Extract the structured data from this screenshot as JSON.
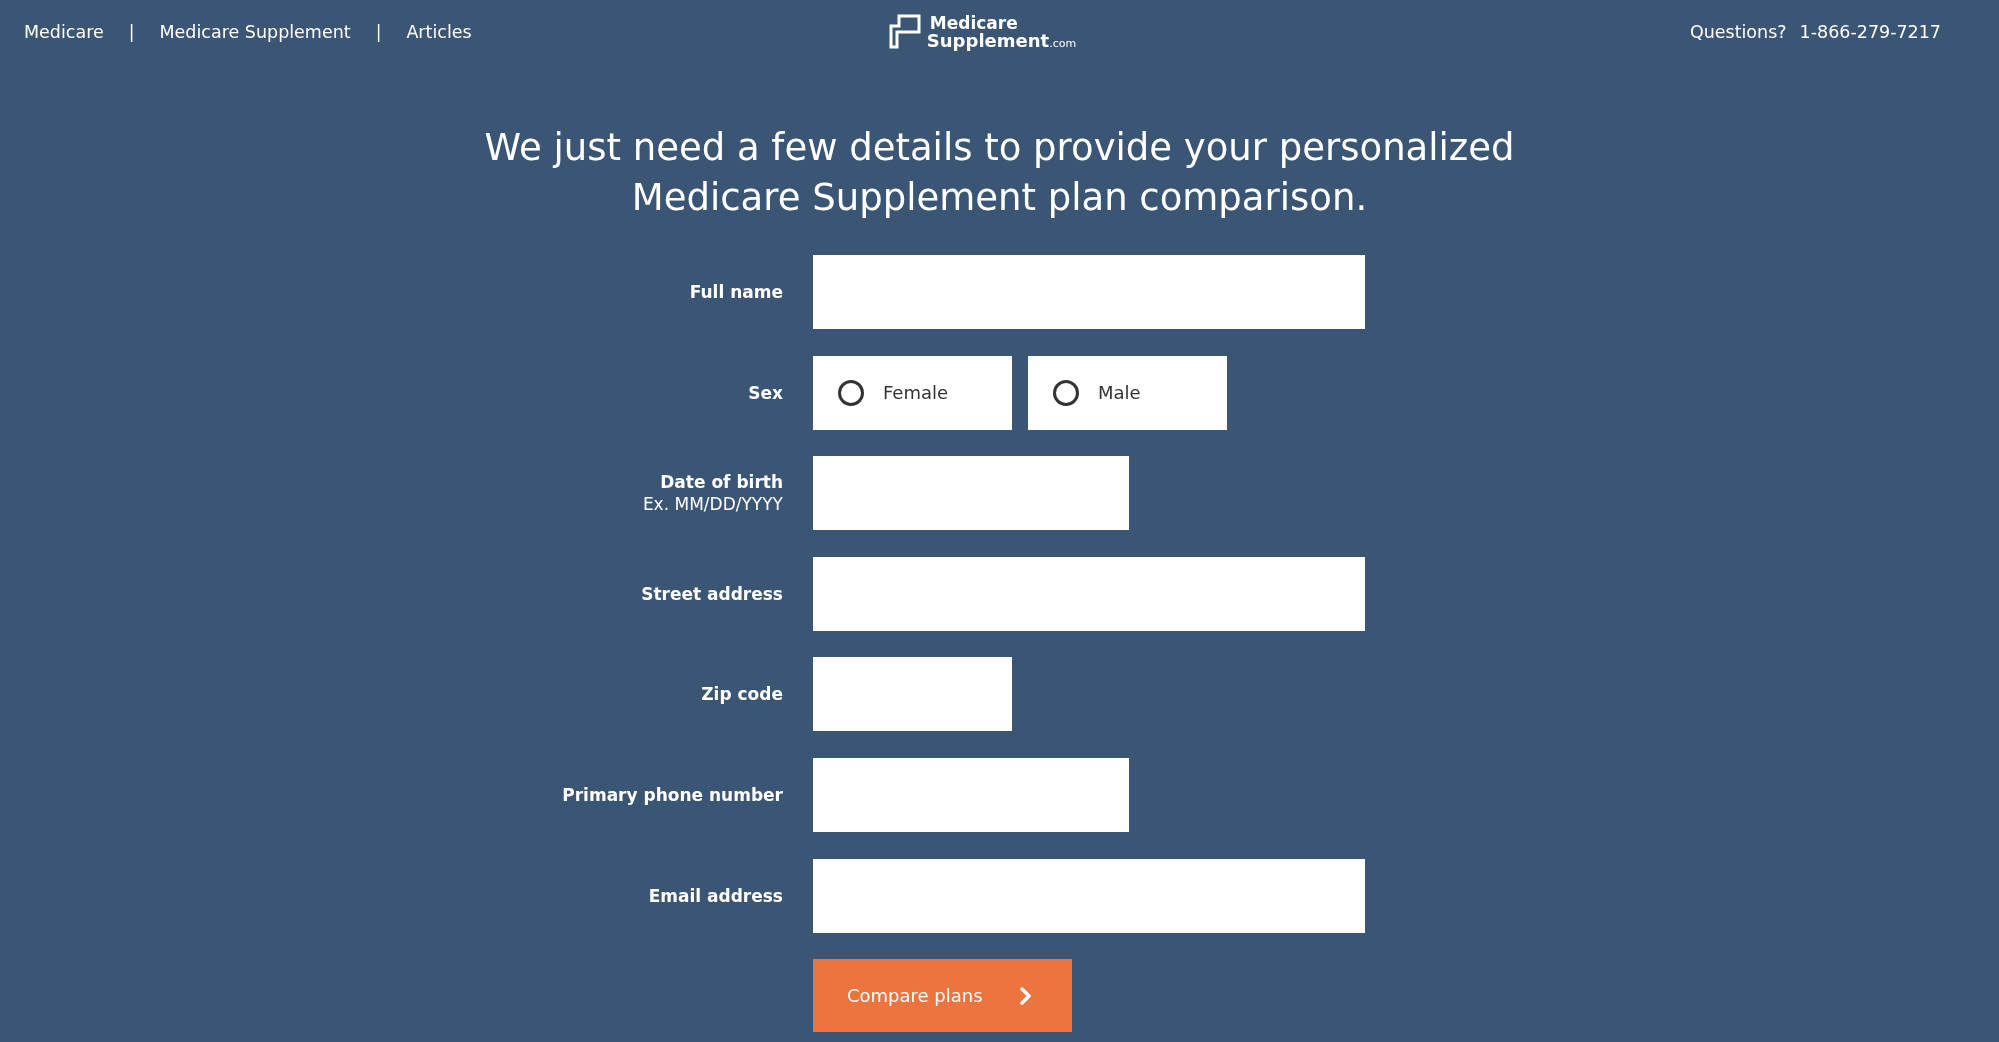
{
  "header": {
    "nav": [
      {
        "kind": "link",
        "text": "Medicare"
      },
      {
        "kind": "separator",
        "text": "|"
      },
      {
        "kind": "link",
        "text": "Medicare Supplement"
      },
      {
        "kind": "separator",
        "text": "|"
      },
      {
        "kind": "link",
        "text": "Articles"
      }
    ],
    "logo": {
      "line_1": "Medicare",
      "line_2": "Supplement",
      "suffix": ".com"
    },
    "contact": {
      "label": "Questions?",
      "phone": "1-866-279-7217"
    }
  },
  "heading": "We just need a few details to provide your personalized Medicare Supplement plan comparison.",
  "form": {
    "fields": [
      {
        "kind": "text",
        "label": "Full name"
      },
      {
        "kind": "radio",
        "label": "Sex",
        "options": [
          {
            "label": "Female",
            "selected": false
          },
          {
            "label": "Male",
            "selected": false
          }
        ]
      },
      {
        "kind": "date",
        "label": "Date of birth",
        "hint": "Ex. MM/DD/YYYY"
      },
      {
        "kind": "text",
        "label": "Street address"
      },
      {
        "kind": "zip",
        "label": "Zip code"
      },
      {
        "kind": "phone",
        "label": "Primary phone number"
      },
      {
        "kind": "text",
        "label": "Email address"
      }
    ],
    "submit": {
      "label": "Compare plans"
    }
  }
}
